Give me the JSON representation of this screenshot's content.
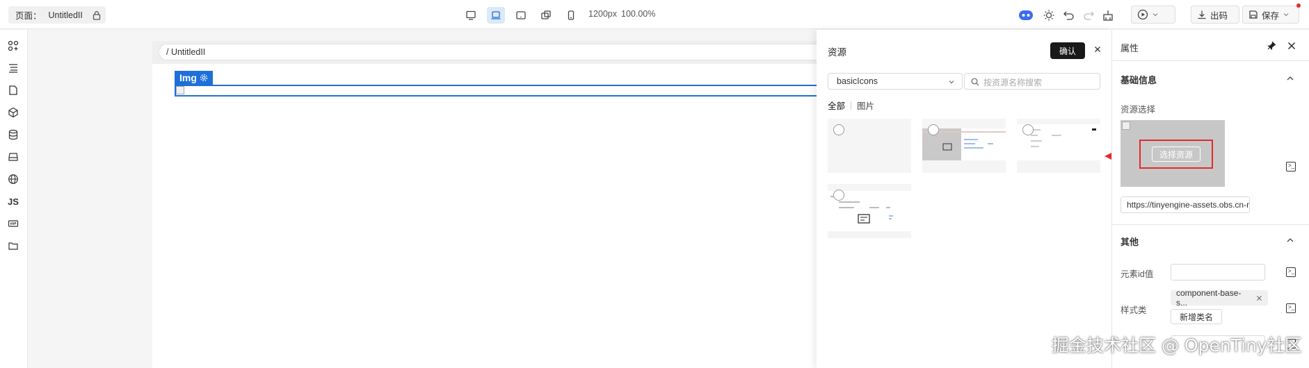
{
  "topbar": {
    "page_label": "页面：",
    "page_name": "UntitledII",
    "resolution": "1200px",
    "zoom": "100.00%",
    "export_label": "出码",
    "save_label": "保存"
  },
  "leftbar": {
    "js_label": "JS"
  },
  "canvas": {
    "breadcrumb": "/ UntitledII",
    "selected_tag": "Img"
  },
  "resource_panel": {
    "title": "资源",
    "confirm_label": "确认",
    "group_select": "basicIcons",
    "search_placeholder": "按资源名称搜索",
    "tabs": [
      "全部",
      "图片"
    ]
  },
  "properties": {
    "title": "属性",
    "basic_section": "基础信息",
    "resource_select_label": "资源选择",
    "choose_resource_button": "选择资源",
    "src_value": "https://tinyengine-assets.obs.cn-north",
    "other_section": "其他",
    "element_id_label": "元素id值",
    "style_class_label": "样式类",
    "class_tag": "component-base-s...",
    "add_class_button": "新增类名"
  },
  "watermark": "掘金技术社区 @ OpenTiny社区",
  "colors": {
    "accent": "#1e6fd9",
    "highlight": "#e12b2b",
    "confirm_bg": "#191919"
  }
}
